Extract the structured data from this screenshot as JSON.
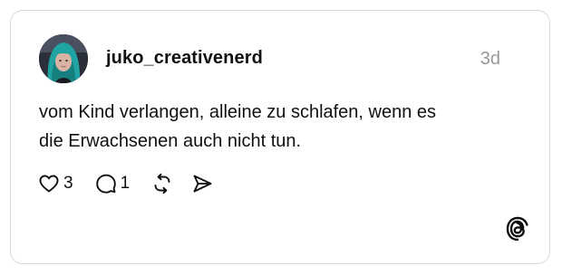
{
  "post": {
    "username": "juko_creativenerd",
    "timestamp": "3d",
    "text_line1": "vom Kind verlangen, alleine zu schlafen, wenn es",
    "text_line2": "die Erwachsenen auch nicht tun."
  },
  "actions": {
    "likes": "3",
    "replies": "1"
  },
  "icons": {
    "like": "heart-icon",
    "reply": "speech-bubble-icon",
    "repost": "repost-icon",
    "share": "send-icon",
    "logo": "threads-logo-icon"
  },
  "colors": {
    "text": "#101010",
    "muted": "#999999",
    "border": "#d8d8d8",
    "avatar_hair": "#1fa3a3"
  }
}
